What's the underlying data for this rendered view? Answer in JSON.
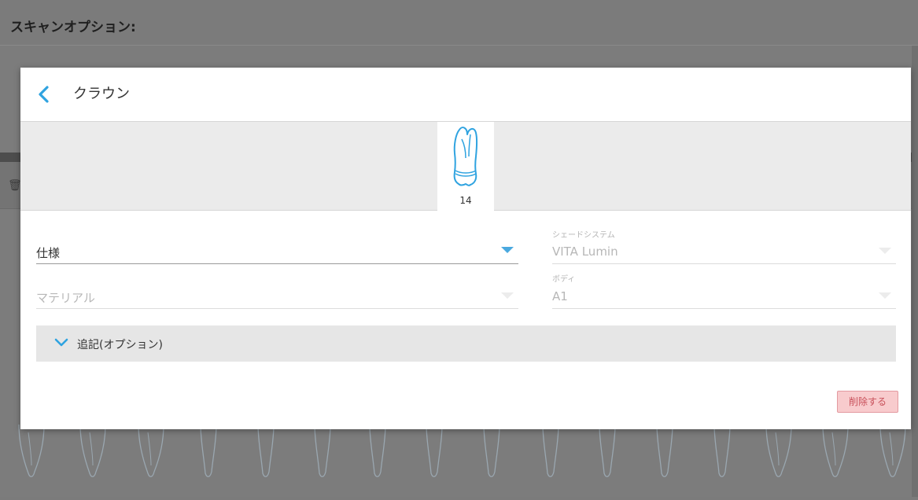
{
  "page": {
    "title": "スキャンオプション:",
    "row_icon": "trash-icon"
  },
  "dialog": {
    "title": "クラウン",
    "back_icon": "chevron-left-icon",
    "tooth": {
      "number": "14",
      "icon": "tooth-icon"
    },
    "fields": {
      "specification": {
        "value": "仕様"
      },
      "material": {
        "value": "マテリアル"
      },
      "shade_system": {
        "caption": "シェードシステム",
        "value": "VITA Lumin"
      },
      "body": {
        "caption": "ボディ",
        "value": "A1"
      }
    },
    "notes": {
      "label": "追記(オプション)",
      "icon": "chevron-down-icon"
    },
    "delete_label": "削除する"
  },
  "colors": {
    "accent": "#4aa9df",
    "danger_bg": "#f8cbcd",
    "danger_text": "#c8505a",
    "overlay": "#7b7b7b"
  }
}
